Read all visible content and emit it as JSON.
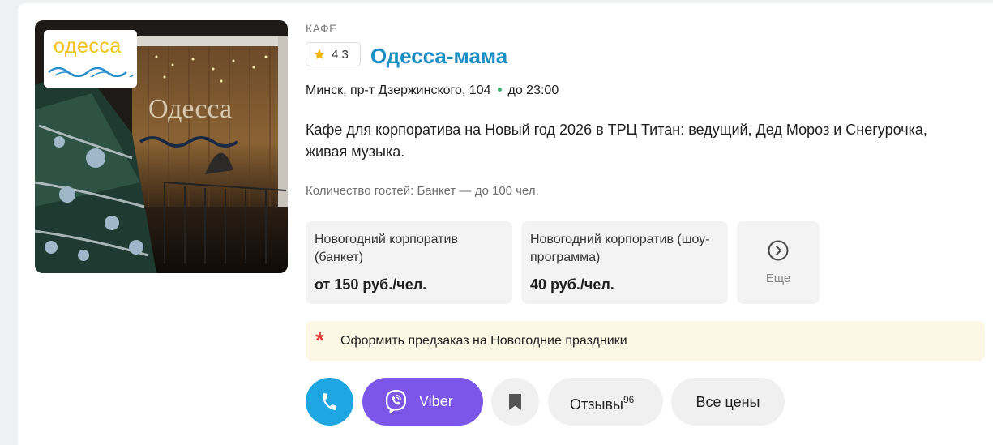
{
  "venue": {
    "category": "КАФЕ",
    "rating": "4.3",
    "name": "Одесса-мама",
    "logo_text": "одесса",
    "address": "Минск, пр-т Дзержинского, 104",
    "hours": "до 23:00",
    "description": "Кафе для корпоратива на Новый год 2026 в ТРЦ Титан: ведущий, Дед Мороз и Снегурочка, живая музыка.",
    "guests": "Количество гостей: Банкет — до 100 чел."
  },
  "offers": [
    {
      "name": "Новогодний корпоратив (банкет)",
      "price": "от 150 руб./чел."
    },
    {
      "name": "Новогодний корпоратив (шоу-программа)",
      "price": "40 руб./чел."
    }
  ],
  "more_label": "Еще",
  "promo": {
    "text": "Оформить предзаказ на Новогодние праздники"
  },
  "actions": {
    "viber_label": "Viber",
    "reviews_label": "Отзывы",
    "reviews_count": "96",
    "prices_label": "Все цены"
  },
  "icons": {
    "rating": "star-icon",
    "more": "chevron-right-circle-icon",
    "promo": "asterisk-icon",
    "phone": "phone-icon",
    "viber": "viber-icon",
    "bookmark": "bookmark-icon"
  },
  "colors": {
    "title": "#1a8fc4",
    "phone_button": "#1ea6e3",
    "viber_button": "#7b56e8",
    "open_dot": "#34b46a",
    "promo_bg": "#fdf8e6",
    "asterisk": "#e23b3b",
    "star": "#f2b705"
  }
}
